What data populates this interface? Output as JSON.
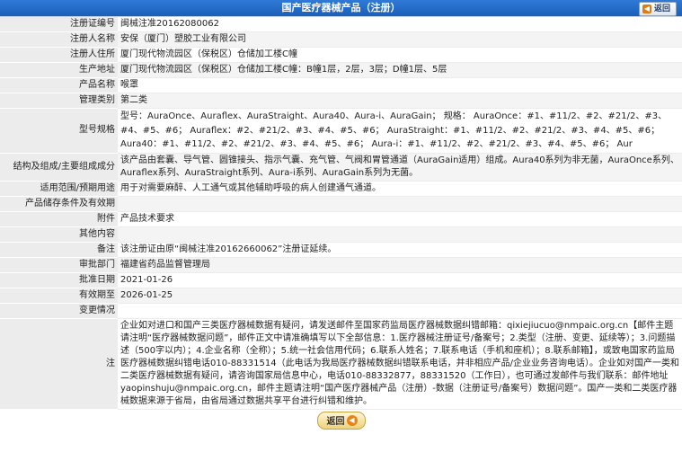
{
  "header": {
    "title": "国产医疗器械产品（注册）",
    "back_label": "返回"
  },
  "rows": {
    "reg_no": {
      "label": "注册证编号",
      "value": "闽械注准20162080062"
    },
    "registrant": {
      "label": "注册人名称",
      "value": "安保（厦门）塑胶工业有限公司"
    },
    "residence": {
      "label": "注册人住所",
      "value": "厦门现代物流园区（保税区）仓储加工楼C幢"
    },
    "production": {
      "label": "生产地址",
      "value": "厦门现代物流园区（保税区）仓储加工楼C幢：B幢1层，2层，3层；D幢1层、5层"
    },
    "product": {
      "label": "产品名称",
      "value": "喉罩"
    },
    "category": {
      "label": "管理类别",
      "value": "第二类"
    },
    "models": {
      "label": "型号规格",
      "value": "型号：AuraOnce、Auraflex、AuraStraight、Aura40、Aura-i、AuraGain；  规格：  AuraOnce：#1、#11/2、#2、#21/2、#3、#4、#5、#6；  Auraflex：#2、#21/2、#3、#4、#5、#6；  AuraStraight：#1、#11/2、#2、#21/2、#3、#4、#5、#6；  Aura40：#1、#11/2、#2、#21/2、#3、#4、#5、#6；  Aura-i：#1、#11/2、#2、#21/2、#3、#4、#5、#6；  Aur"
    },
    "structure": {
      "label": "结构及组成/主要组成成分",
      "value": "该产品由套囊、导气管、圆锥接头、指示气囊、充气管、气阀和胃管通道（AuraGain适用）组成。Aura40系列为非无菌，AuraOnce系列、Auraflex系列、AuraStraight系列、Aura-i系列、AuraGain系列为无菌。"
    },
    "scope": {
      "label": "适用范围/预期用途",
      "value": "用于对需要麻醉、人工通气或其他辅助呼吸的病人创建通气通道。"
    },
    "storage": {
      "label": "产品储存条件及有效期",
      "value": ""
    },
    "attachment": {
      "label": "附件",
      "value": "产品技术要求"
    },
    "other": {
      "label": "其他内容",
      "value": ""
    },
    "remark": {
      "label": "备注",
      "value": "该注册证由原“闽械注准20162660062”注册证延续。"
    },
    "dept": {
      "label": "审批部门",
      "value": "福建省药品监督管理局"
    },
    "approve_date": {
      "label": "批准日期",
      "value": "2021-01-26"
    },
    "valid_until": {
      "label": "有效期至",
      "value": "2026-01-25"
    },
    "change": {
      "label": "变更情况",
      "value": ""
    },
    "note": {
      "label": "注",
      "value": "企业如对进口和国产三类医疗器械数据有疑问，请发送邮件至国家药监局医疗器械数据纠错邮箱：qixiejiucuo@nmpaic.org.cn【邮件主题请注明“医疗器械数据问题”，邮件正文中请准确填写以下全部信息：1.医疗器械注册证号/备案号；2.类型（注册、变更、延续等）；3.问题描述（500字以内）；4.企业名称（全称）；5.统一社会信用代码；6.联系人姓名；7.联系电话（手机和座机）；8.联系邮箱】，或致电国家药监局医疗器械数据纠错电话010-88331514（此电话为我局医疗器械数据纠错联系电话，并非相应产品/企业业务咨询电话）。企业如对国产一类和二类医疗器械数据有疑问，请咨询国家局信息中心，电话010-88332877，88331520（工作日），也可通过发邮件与我们联系：邮件地址yaopinshuju@nmpaic.org.cn，邮件主题请注明“国产医疗器械产品（注册）-数据（注册证号/备案号）数据问题”。国产一类和二类医疗器械数据来源于省局，由省局通过数据共享平台进行纠错和维护。"
    }
  },
  "footer": {
    "back_label": "返回"
  },
  "colors": {
    "header_bg": "#1a5fb8",
    "label_bg": "#ececec",
    "alt_row_bg": "#f4f4f4",
    "button_orange": "#e6841a"
  }
}
